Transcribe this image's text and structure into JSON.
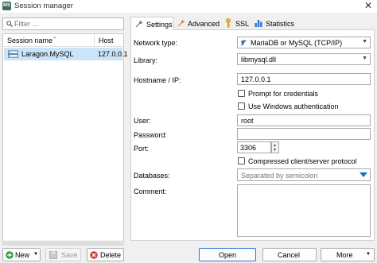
{
  "window": {
    "title": "Session manager",
    "app_icon_text": "MS",
    "close_glyph": "✕"
  },
  "filter": {
    "placeholder": "Filter ..."
  },
  "session_list": {
    "columns": [
      {
        "label": "Session name",
        "sort": "ascending"
      },
      {
        "label": "Host"
      }
    ],
    "rows": [
      {
        "name": "Laragon.MySQL",
        "host": "127.0.0.1",
        "selected": true
      }
    ]
  },
  "tabs": [
    {
      "label": "Settings",
      "icon": "wrench-icon",
      "active": true
    },
    {
      "label": "Advanced",
      "icon": "wrench-icon"
    },
    {
      "label": "SSL",
      "icon": "key-icon"
    },
    {
      "label": "Statistics",
      "icon": "bar-chart-icon"
    }
  ],
  "settings": {
    "network_type": {
      "label": "Network type:",
      "value": "MariaDB or MySQL (TCP/IP)"
    },
    "library": {
      "label": "Library:",
      "value": "libmysql.dll"
    },
    "hostname": {
      "label": "Hostname / IP:",
      "value": "127.0.0.1"
    },
    "prompt_credentials": {
      "label": "Prompt for credentials",
      "checked": false
    },
    "windows_auth": {
      "label": "Use Windows authentication",
      "checked": false
    },
    "user": {
      "label": "User:",
      "value": "root"
    },
    "password": {
      "label": "Password:",
      "value": ""
    },
    "port": {
      "label": "Port:",
      "value": "3306"
    },
    "compressed": {
      "label": "Compressed client/server protocol",
      "checked": false
    },
    "databases": {
      "label": "Databases:",
      "placeholder": "Separated by semicolon"
    },
    "comment": {
      "label": "Comment:",
      "value": ""
    }
  },
  "buttons": {
    "new": "New",
    "save": "Save",
    "delete": "Delete",
    "open": "Open",
    "cancel": "Cancel",
    "more": "More"
  },
  "colors": {
    "accent": "#1a73c9",
    "selection": "#cce4f7",
    "delete_red": "#d9342b",
    "new_green": "#2e9b3e"
  }
}
